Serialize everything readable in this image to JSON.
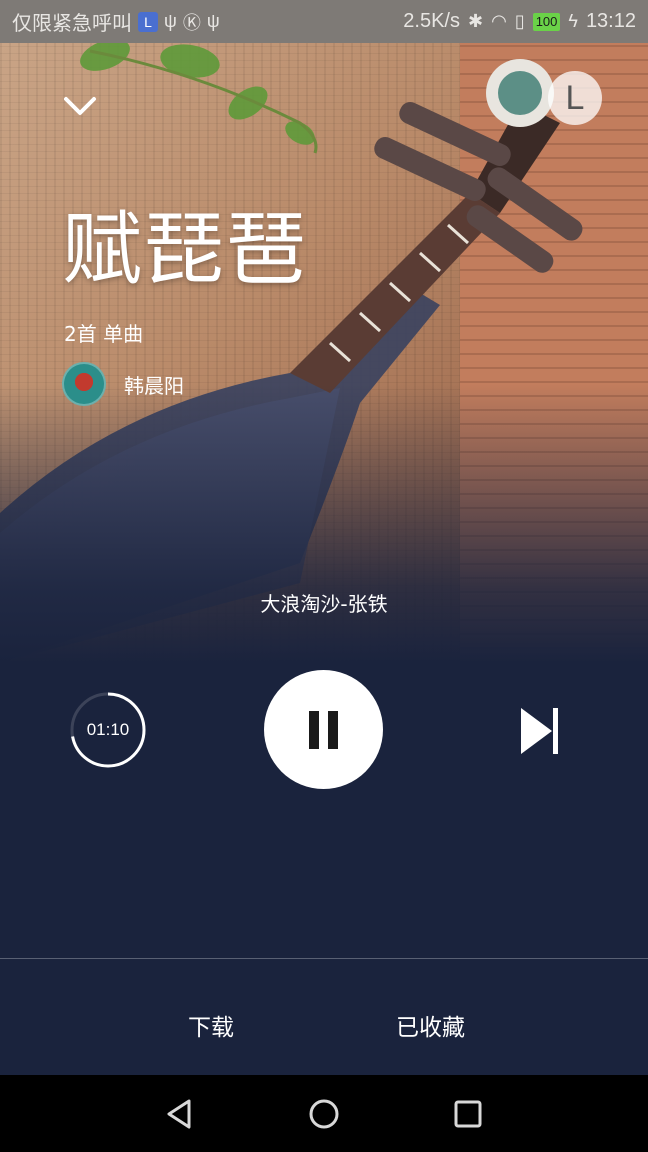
{
  "status_bar": {
    "left_text": "仅限紧急呼叫",
    "badge": "L",
    "icons": [
      "usb-icon",
      "k-circle-icon",
      "usb-icon"
    ],
    "speed": "2.5K/s",
    "battery": "100",
    "time": "13:12"
  },
  "header": {
    "collapse_icon": "chevron-down-icon",
    "avatar_letter": "L"
  },
  "album": {
    "title": "赋琵琶",
    "meta": "2首 单曲",
    "artist": "韩晨阳"
  },
  "now_playing": "大浪淘沙-张铁",
  "player": {
    "timer": "01:10",
    "timer_progress": 0.72,
    "state": "playing",
    "next_icon": "skip-next-icon"
  },
  "actions": {
    "download": "下载",
    "collected": "已收藏"
  },
  "nav": {
    "back_icon": "back-triangle-icon",
    "home_icon": "home-circle-icon",
    "recents_icon": "recents-square-icon"
  },
  "colors": {
    "background": "#1a233d",
    "status_bar": "#7e7a76",
    "battery": "#6ad248"
  }
}
